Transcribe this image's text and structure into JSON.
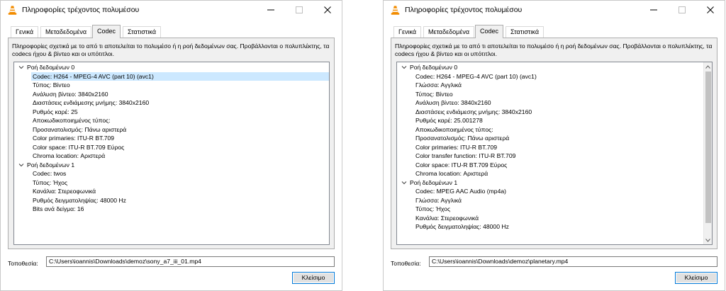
{
  "windows": [
    {
      "title": "Πληροφορίες τρέχοντος πολυμέσου",
      "tabs": [
        {
          "label": "Γενικά",
          "active": false
        },
        {
          "label": "Μεταδεδομένα",
          "active": false
        },
        {
          "label": "Codec",
          "active": true
        },
        {
          "label": "Στατιστικά",
          "active": false
        }
      ],
      "description": "Πληροφορίες σχετικά με το από τι αποτελείται το πολυμέσο ή η ροή δεδομένων σας. Προβάλλονται ο πολυπλέκτης, τα codecs ήχου & βίντεο και οι υπότιτλοι.",
      "tree": [
        {
          "kind": "group",
          "label": "Ροή δεδομένων 0",
          "expanded": true
        },
        {
          "kind": "child",
          "label": "Codec: H264 - MPEG-4 AVC (part 10) (avc1)",
          "selected": true
        },
        {
          "kind": "child",
          "label": "Τύπος: Βίντεο"
        },
        {
          "kind": "child",
          "label": "Ανάλυση βίντεο: 3840x2160"
        },
        {
          "kind": "child",
          "label": "Διαστάσεις ενδιάμεσης μνήμης: 3840x2160"
        },
        {
          "kind": "child",
          "label": "Ρυθμός καρέ: 25"
        },
        {
          "kind": "child",
          "label": "Αποκωδικοποιημένος τύπος:"
        },
        {
          "kind": "child",
          "label": "Προσανατολισμός: Πάνω αριστερά"
        },
        {
          "kind": "child",
          "label": "Color primaries: ITU-R BT.709"
        },
        {
          "kind": "child",
          "label": "Color space: ITU-R BT.709 Εύρος"
        },
        {
          "kind": "child",
          "label": "Chroma location: Αριστερά"
        },
        {
          "kind": "group",
          "label": "Ροή δεδομένων 1",
          "expanded": true
        },
        {
          "kind": "child",
          "label": "Codec: twos"
        },
        {
          "kind": "child",
          "label": "Τύπος: Ήχος"
        },
        {
          "kind": "child",
          "label": "Κανάλια: Στερεοφωνικά"
        },
        {
          "kind": "child",
          "label": "Ρυθμός δειγματοληψίας: 48000 Hz"
        },
        {
          "kind": "child",
          "label": "Bits ανά δείγμα: 16"
        }
      ],
      "scrollbar": false,
      "location_label": "Τοποθεσία:",
      "location_value": "C:\\Users\\ioannis\\Downloads\\demoz\\sony_a7_iii_01.mp4",
      "close_label": "Κλείσιμο"
    },
    {
      "title": "Πληροφορίες τρέχοντος πολυμέσου",
      "tabs": [
        {
          "label": "Γενικά",
          "active": false
        },
        {
          "label": "Μεταδεδομένα",
          "active": false
        },
        {
          "label": "Codec",
          "active": true
        },
        {
          "label": "Στατιστικά",
          "active": false
        }
      ],
      "description": "Πληροφορίες σχετικά με το από τι αποτελείται το πολυμέσο ή η ροή δεδομένων σας. Προβάλλονται ο πολυπλέκτης, τα codecs ήχου & βίντεο και οι υπότιτλοι.",
      "tree": [
        {
          "kind": "group",
          "label": "Ροή δεδομένων 0",
          "expanded": true
        },
        {
          "kind": "child",
          "label": "Codec: H264 - MPEG-4 AVC (part 10) (avc1)"
        },
        {
          "kind": "child",
          "label": "Γλώσσα: Αγγλικά"
        },
        {
          "kind": "child",
          "label": "Τύπος: Βίντεο"
        },
        {
          "kind": "child",
          "label": "Ανάλυση βίντεο: 3840x2160"
        },
        {
          "kind": "child",
          "label": "Διαστάσεις ενδιάμεσης μνήμης: 3840x2160"
        },
        {
          "kind": "child",
          "label": "Ρυθμός καρέ: 25.001278"
        },
        {
          "kind": "child",
          "label": "Αποκωδικοποιημένος τύπος:"
        },
        {
          "kind": "child",
          "label": "Προσανατολισμός: Πάνω αριστερά"
        },
        {
          "kind": "child",
          "label": "Color primaries: ITU-R BT.709"
        },
        {
          "kind": "child",
          "label": "Color transfer function: ITU-R BT.709"
        },
        {
          "kind": "child",
          "label": "Color space: ITU-R BT.709 Εύρος"
        },
        {
          "kind": "child",
          "label": "Chroma location: Αριστερά"
        },
        {
          "kind": "group",
          "label": "Ροή δεδομένων 1",
          "expanded": true
        },
        {
          "kind": "child",
          "label": "Codec: MPEG AAC Audio (mp4a)"
        },
        {
          "kind": "child",
          "label": "Γλώσσα: Αγγλικά"
        },
        {
          "kind": "child",
          "label": "Τύπος: Ήχος"
        },
        {
          "kind": "child",
          "label": "Κανάλια: Στερεοφωνικά"
        },
        {
          "kind": "child",
          "label": "Ρυθμός δειγματοληψίας: 48000 Hz"
        }
      ],
      "scrollbar": true,
      "location_label": "Τοποθεσία:",
      "location_value": "C:\\Users\\ioannis\\Downloads\\demoz\\planetary.mp4",
      "close_label": "Κλείσιμο"
    }
  ],
  "icons": {
    "app": "vlc-cone-icon",
    "minimize": "minimize-icon",
    "maximize": "maximize-icon",
    "close": "close-icon",
    "expand": "chevron-down-icon"
  },
  "colors": {
    "accent": "#0078d7",
    "selection": "#cce8ff",
    "cone_orange": "#f28c00"
  }
}
